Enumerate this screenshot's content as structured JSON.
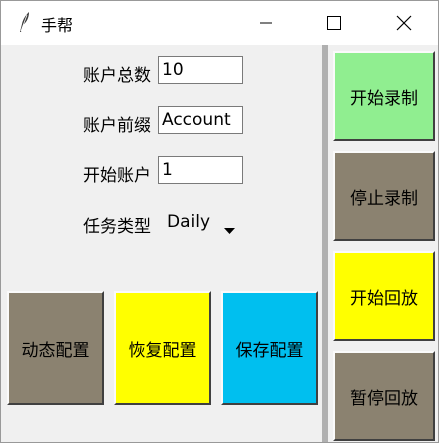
{
  "window": {
    "title": "手帮",
    "icon": "feather-icon",
    "controls": [
      "minimize-icon",
      "maximize-icon",
      "close-icon"
    ]
  },
  "form": {
    "account_total_label": "账户总数",
    "account_total_value": "10",
    "account_prefix_label": "账户前缀",
    "account_prefix_value": "Account",
    "start_account_label": "开始账户",
    "start_account_value": "1",
    "task_type_label": "任务类型",
    "task_type_value": "Daily"
  },
  "config_buttons": {
    "dynamic": {
      "label": "动态配置",
      "color": "#8b8270"
    },
    "restore": {
      "label": "恢复配置",
      "color": "#ffff00"
    },
    "save": {
      "label": "保存配置",
      "color": "#00bfef"
    }
  },
  "side_buttons": {
    "start_record": {
      "label": "开始录制",
      "color": "#90ee90"
    },
    "stop_record": {
      "label": "停止录制",
      "color": "#8b8270"
    },
    "start_playback": {
      "label": "开始回放",
      "color": "#ffff00"
    },
    "pause_playback": {
      "label": "暂停回放",
      "color": "#8b8270"
    }
  }
}
